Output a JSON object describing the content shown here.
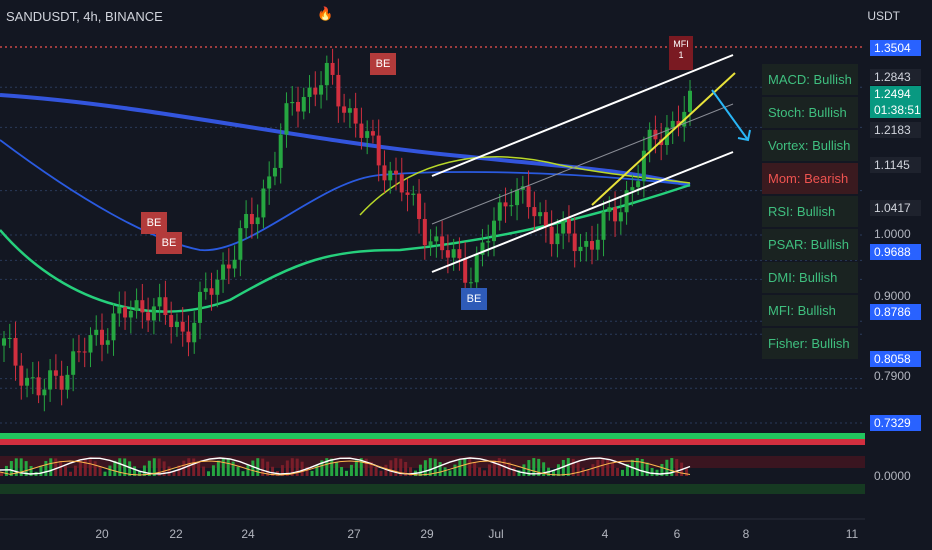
{
  "header": {
    "symbol": "SANDUSDT, 4h, BINANCE",
    "currency": "USDT",
    "flame_icon": "flame-icon"
  },
  "price_axis": {
    "tags": [
      {
        "text": "1.3504",
        "style": "blue"
      },
      {
        "text": "1.2843",
        "style": "dark"
      },
      {
        "text": "1.2183",
        "style": "dark"
      },
      {
        "text": "1.1145",
        "style": "dark"
      },
      {
        "text": "1.0417",
        "style": "dark"
      },
      {
        "text": "1.0000",
        "style": "plain"
      },
      {
        "text": "0.9688",
        "style": "blue"
      },
      {
        "text": "0.9000",
        "style": "plain"
      },
      {
        "text": "0.8786",
        "style": "blue"
      },
      {
        "text": "0.8058",
        "style": "blue"
      },
      {
        "text": "0.7900",
        "style": "plain"
      },
      {
        "text": "0.7329",
        "style": "blue"
      },
      {
        "text": "0.0000",
        "style": "plain"
      }
    ],
    "current_price": "1.2494",
    "countdown": "01:38:51",
    "current_color": "#089981"
  },
  "indicator_panel": [
    {
      "text": "MACD: Bullish",
      "state": "bull"
    },
    {
      "text": "Stoch: Bullish",
      "state": "bull"
    },
    {
      "text": "Vortex: Bullish",
      "state": "bull"
    },
    {
      "text": "Mom: Bearish",
      "state": "bear"
    },
    {
      "text": "RSI: Bullish",
      "state": "bull"
    },
    {
      "text": "PSAR: Bullish",
      "state": "bull"
    },
    {
      "text": "DMI: Bullish",
      "state": "bull"
    },
    {
      "text": "MFI: Bullish",
      "state": "bull"
    },
    {
      "text": "Fisher: Bullish",
      "state": "bull"
    }
  ],
  "markers": {
    "bear_label": "BE",
    "bull_label": "BE",
    "mfi_label": "MFI",
    "mfi_count": "1"
  },
  "chart_data": {
    "type": "candlestick",
    "title": "SANDUSDT, 4h, BINANCE",
    "x_ticks": [
      "20",
      "22",
      "24",
      "27",
      "29",
      "Jul",
      "4",
      "6",
      "8",
      "11"
    ],
    "ylim": [
      0.7329,
      1.3504
    ],
    "y_ticks": [
      1.3504,
      1.2843,
      1.2183,
      1.1145,
      1.0417,
      1.0,
      0.9688,
      0.9,
      0.8786,
      0.8058,
      0.79,
      0.7329
    ],
    "key_prices": {
      "high": 1.3504,
      "low": 0.7329,
      "last": 1.2494
    },
    "price_path": [
      {
        "x": "19",
        "y": 0.86
      },
      {
        "x": "19.5",
        "y": 0.78
      },
      {
        "x": "20",
        "y": 0.84
      },
      {
        "x": "21",
        "y": 0.9
      },
      {
        "x": "22",
        "y": 0.93
      },
      {
        "x": "22.5",
        "y": 0.88
      },
      {
        "x": "23",
        "y": 0.98
      },
      {
        "x": "24",
        "y": 1.08
      },
      {
        "x": "25",
        "y": 1.26
      },
      {
        "x": "26",
        "y": 1.3
      },
      {
        "x": "27",
        "y": 1.2
      },
      {
        "x": "28",
        "y": 1.12
      },
      {
        "x": "29",
        "y": 1.02
      },
      {
        "x": "30",
        "y": 0.98
      },
      {
        "x": "Jul",
        "y": 1.12
      },
      {
        "x": "2",
        "y": 1.06
      },
      {
        "x": "3",
        "y": 1.02
      },
      {
        "x": "4",
        "y": 1.08
      },
      {
        "x": "5",
        "y": 1.2
      },
      {
        "x": "6",
        "y": 1.25
      }
    ],
    "moving_averages": [
      "blue-slow",
      "navy-fast",
      "green",
      "lime"
    ],
    "channel": "ascending",
    "projection_arrow": "down"
  }
}
